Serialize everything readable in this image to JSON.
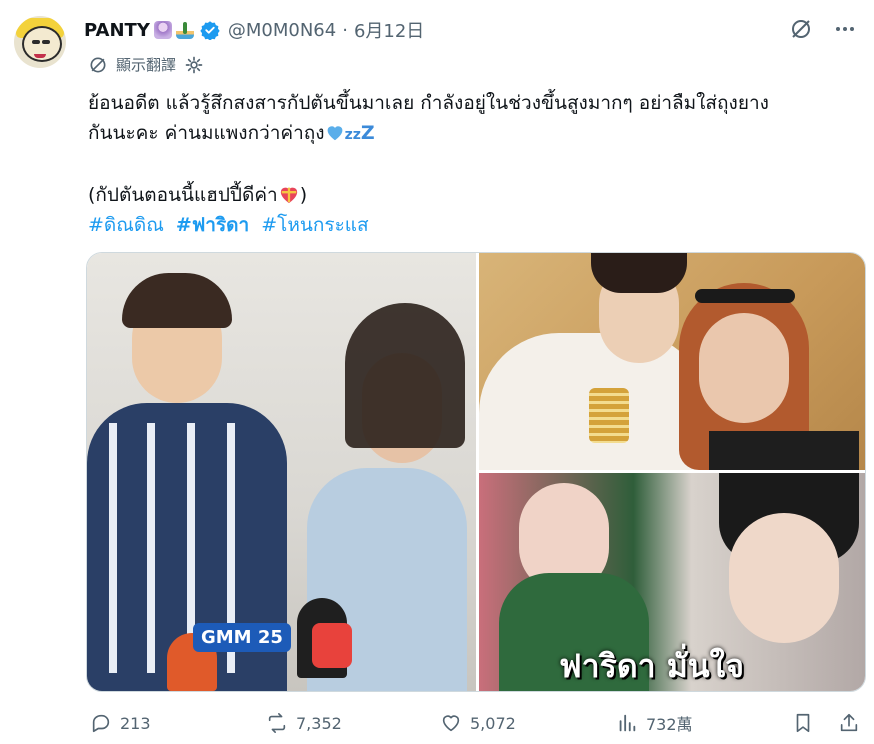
{
  "author": {
    "name": "PANTY",
    "handle": "@M0M0N64",
    "date": "6月12日",
    "verified": true,
    "emoji_icons": [
      "fairy-emoji",
      "desert-island-emoji"
    ]
  },
  "translate": {
    "label": "顯示翻譯"
  },
  "tweet": {
    "line1": "ย้อนอดีต แล้วรู้สึกสงสารกัปตันขึ้นมาเลย กำลังอยู่ในช่วงขึ้นสูงมากๆ อย่าลืมใส่ถุงยาง",
    "line2": "กันนะคะ ค่านมแพงกว่าค่าถุง",
    "line4": "(กัปตันตอนนี้แฮปปี้ดีค่า",
    "line4_end": ")",
    "hashtags": [
      "#ดิณดิณ",
      "#ฟาริดา",
      "#โหนกระแส"
    ]
  },
  "media": {
    "image_count": 3,
    "overlay_text": "ฟาริดา มั่นใจ",
    "logo_text": "GMM 25"
  },
  "stats": {
    "replies": "213",
    "reposts": "7,352",
    "likes": "5,072",
    "views": "732萬"
  },
  "colors": {
    "accent": "#1d9bf0",
    "muted": "#536471",
    "text": "#0f1419"
  }
}
